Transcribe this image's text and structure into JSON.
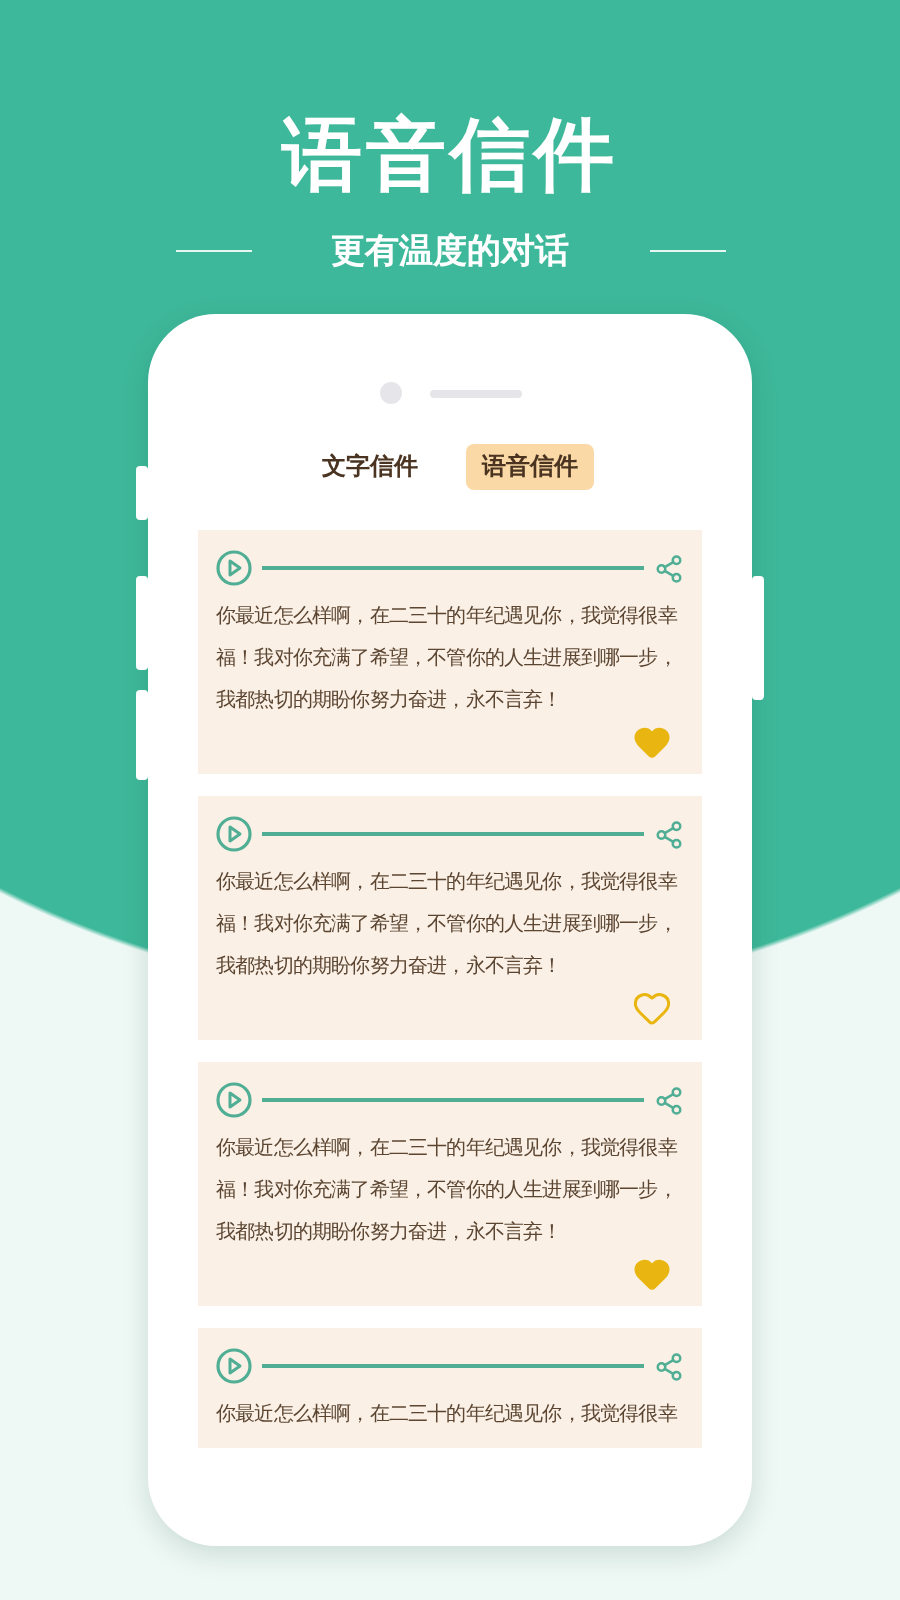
{
  "header": {
    "title": "语音信件",
    "subtitle": "更有温度的对话"
  },
  "tabs": [
    {
      "label": "文字信件",
      "selected": false
    },
    {
      "label": "语音信件",
      "selected": true
    }
  ],
  "letters": [
    {
      "text": "你最近怎么样啊，在二三十的年纪遇见你，我觉得很幸福！我对你充满了希望，不管你的人生进展到哪一步，我都热切的期盼你努力奋进，永不言弃！",
      "liked": true
    },
    {
      "text": "你最近怎么样啊，在二三十的年纪遇见你，我觉得很幸福！我对你充满了希望，不管你的人生进展到哪一步，我都热切的期盼你努力奋进，永不言弃！",
      "liked": false
    },
    {
      "text": "你最近怎么样啊，在二三十的年纪遇见你，我觉得很幸福！我对你充满了希望，不管你的人生进展到哪一步，我都热切的期盼你努力奋进，永不言弃！",
      "liked": true
    },
    {
      "text": "你最近怎么样啊，在二三十的年纪遇见你，我觉得很幸"
    }
  ]
}
